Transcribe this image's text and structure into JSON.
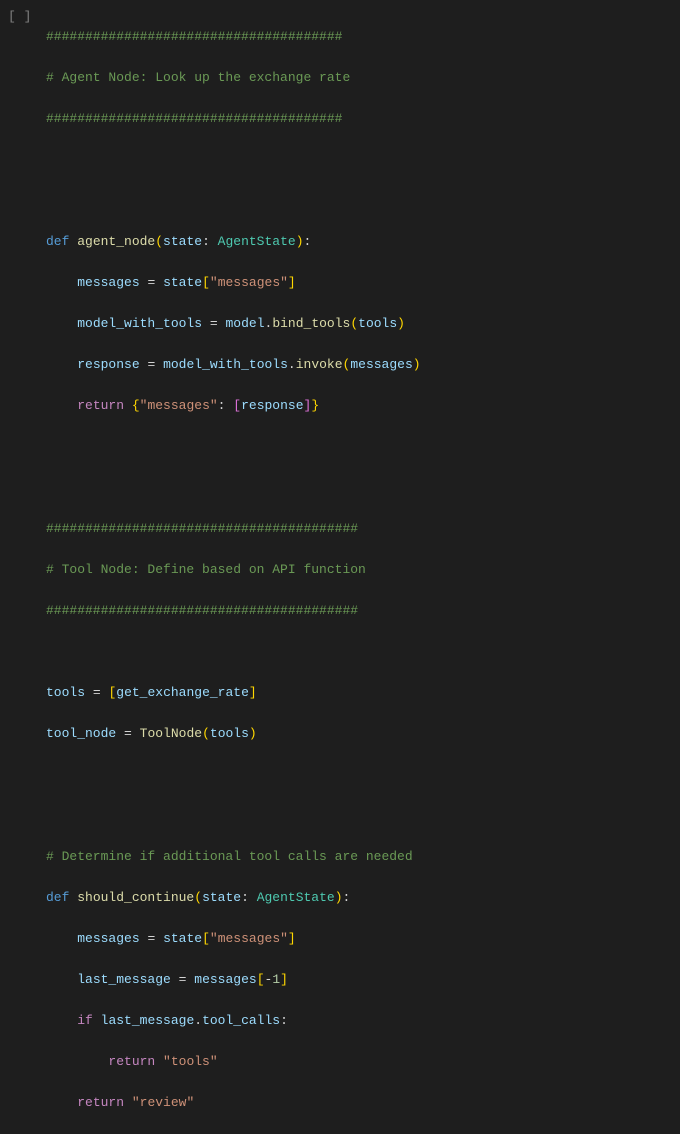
{
  "cell_marker": "[ ]",
  "code": {
    "l1_hashes": "######################################",
    "l2_comment": "# Agent Node: Look up the exchange rate",
    "l3_hashes": "######################################",
    "def1_kw": "def",
    "def1_name": "agent_node",
    "def1_param": "state",
    "def1_type": "AgentState",
    "v_messages": "messages",
    "v_state": "state",
    "s_messages": "\"messages\"",
    "v_model_with_tools": "model_with_tools",
    "v_model": "model",
    "m_bind_tools": "bind_tools",
    "v_tools": "tools",
    "v_response": "response",
    "m_invoke": "invoke",
    "kw_return": "return",
    "l7_hashes": "########################################",
    "l8_comment": "# Tool Node: Define based on API function",
    "l9_hashes": "########################################",
    "v_get_exchange_rate": "get_exchange_rate",
    "v_tool_node": "tool_node",
    "c_ToolNode": "ToolNode",
    "l_det_comment": "# Determine if additional tool calls are needed",
    "def2_name": "should_continue",
    "v_last_message": "last_message",
    "n_neg1": "-1",
    "kw_if": "if",
    "attr_tool_calls": "tool_calls",
    "s_tools": "\"tools\"",
    "s_review": "\"review\""
  }
}
